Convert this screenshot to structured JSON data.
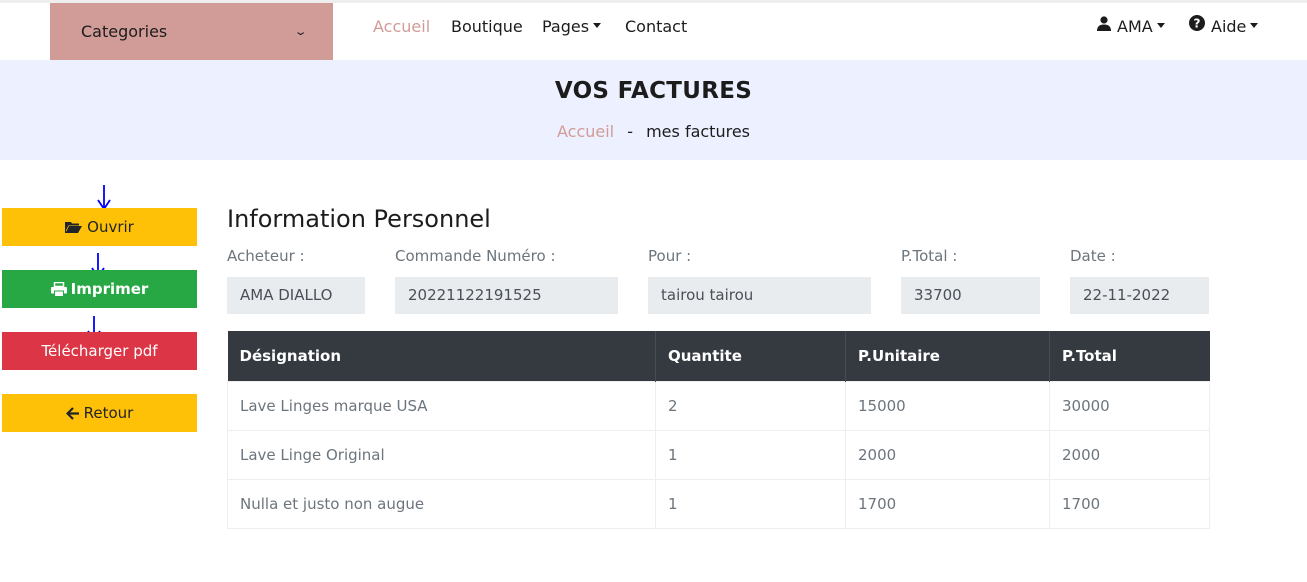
{
  "nav": {
    "categories_label": "Categories",
    "links": {
      "accueil": "Accueil",
      "boutique": "Boutique",
      "pages": "Pages",
      "contact": "Contact"
    },
    "user_label": "AMA",
    "help_label": "Aide",
    "icons": {
      "user": "user-icon",
      "help": "question-circle-icon",
      "dropdown": "chevron-down-icon"
    }
  },
  "header": {
    "title": "VOS FACTURES",
    "breadcrumb_home": "Accueil",
    "breadcrumb_sep": "-",
    "breadcrumb_current": "mes factures"
  },
  "actions": {
    "open": "Ouvrir",
    "print": "Imprimer",
    "download": "Télécharger pdf",
    "back": "Retour",
    "icons": {
      "open": "folder-open-icon",
      "print": "printer-icon",
      "back": "arrow-left-icon",
      "annotation": "blue-arrow-down-icon"
    }
  },
  "info": {
    "title": "Information Personnel",
    "fields": [
      {
        "label": "Acheteur :",
        "value": "AMA DIALLO"
      },
      {
        "label": "Commande Numéro :",
        "value": "20221122191525"
      },
      {
        "label": "Pour :",
        "value": "tairou tairou"
      },
      {
        "label": "P.Total :",
        "value": "33700"
      },
      {
        "label": "Date :",
        "value": "22-11-2022"
      }
    ]
  },
  "table": {
    "headers": [
      "Désignation",
      "Quantite",
      "P.Unitaire",
      "P.Total"
    ],
    "rows": [
      [
        "Lave Linges marque USA",
        "2",
        "15000",
        "30000"
      ],
      [
        "Lave Linge Original",
        "1",
        "2000",
        "2000"
      ],
      [
        "Nulla et justo non augue",
        "1",
        "1700",
        "1700"
      ]
    ]
  },
  "colors": {
    "accent": "#d19c97",
    "hero_bg": "#edf1ff",
    "yellow": "#ffc107",
    "green": "#28a745",
    "red": "#dc3545",
    "table_head": "#343a40",
    "annotation": "#0000ff"
  }
}
